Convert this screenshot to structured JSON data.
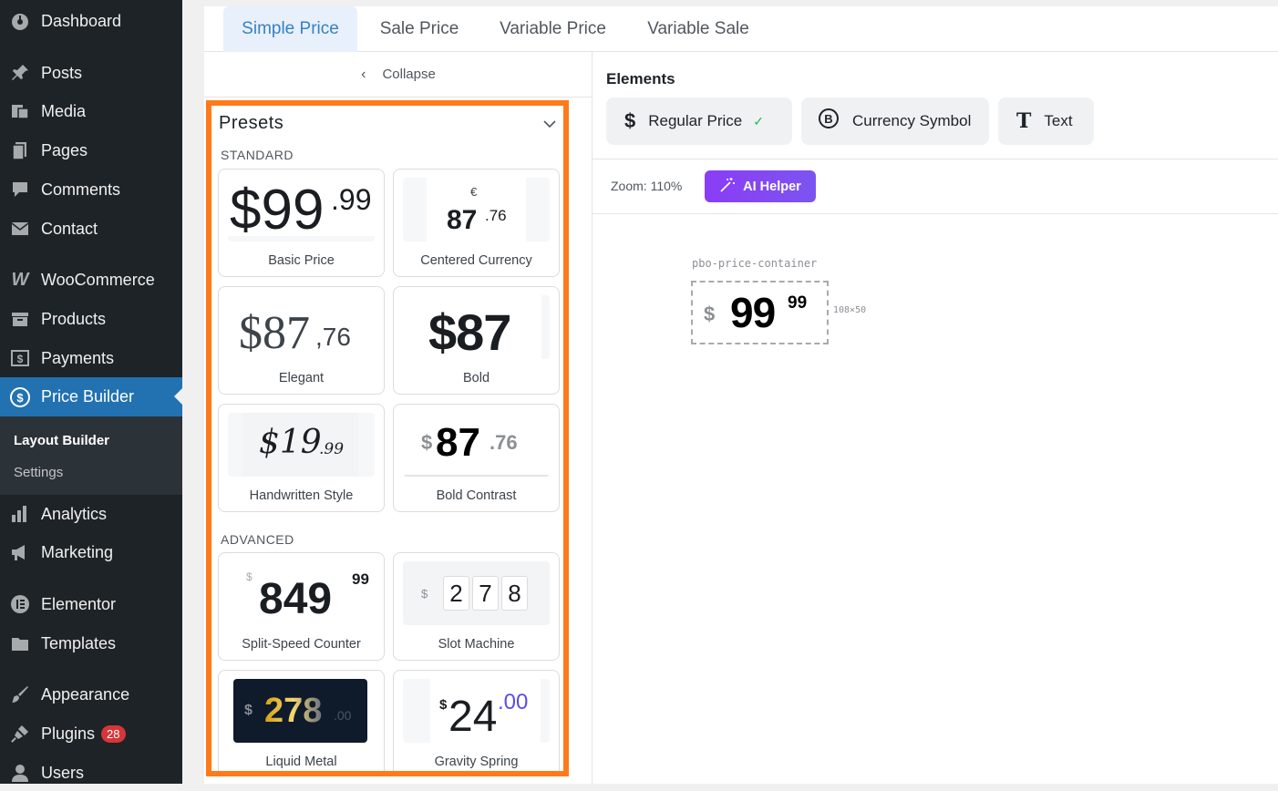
{
  "sidebar": {
    "items": [
      {
        "label": "Dashboard",
        "icon": "dashboard-icon"
      },
      {
        "label": "Posts",
        "icon": "pin-icon"
      },
      {
        "label": "Media",
        "icon": "media-icon"
      },
      {
        "label": "Pages",
        "icon": "pages-icon"
      },
      {
        "label": "Comments",
        "icon": "comment-icon"
      },
      {
        "label": "Contact",
        "icon": "mail-icon"
      },
      {
        "label": "WooCommerce",
        "icon": "woo-icon"
      },
      {
        "label": "Products",
        "icon": "archive-icon"
      },
      {
        "label": "Payments",
        "icon": "payment-icon"
      },
      {
        "label": "Price Builder",
        "icon": "dollar-circle-icon"
      },
      {
        "label": "Analytics",
        "icon": "bar-chart-icon"
      },
      {
        "label": "Marketing",
        "icon": "megaphone-icon"
      },
      {
        "label": "Elementor",
        "icon": "elementor-icon"
      },
      {
        "label": "Templates",
        "icon": "folder-icon"
      },
      {
        "label": "Appearance",
        "icon": "brush-icon"
      },
      {
        "label": "Plugins",
        "icon": "plugin-icon",
        "badge": "28"
      },
      {
        "label": "Users",
        "icon": "user-icon"
      }
    ],
    "submenu": [
      {
        "label": "Layout Builder"
      },
      {
        "label": "Settings"
      }
    ]
  },
  "tabs": [
    "Simple Price",
    "Sale Price",
    "Variable Price",
    "Variable Sale"
  ],
  "collapse_label": "Collapse",
  "presets": {
    "title": "Presets",
    "standard_label": "STANDARD",
    "advanced_label": "ADVANCED",
    "cards": [
      {
        "label": "Basic Price",
        "main": "$99",
        "cents": ".99"
      },
      {
        "label": "Centered Currency",
        "currency": "€",
        "main": "87",
        "cents": ".76"
      },
      {
        "label": "Elegant",
        "main": "$87",
        "cents": ",76"
      },
      {
        "label": "Bold",
        "main": "$87"
      },
      {
        "label": "Handwritten Style",
        "main": "$19",
        "cents": ".99"
      },
      {
        "label": "Bold Contrast",
        "currency": "$",
        "main": "87",
        "cents": ".76"
      },
      {
        "label": "Split-Speed Counter",
        "currency": "$",
        "main": "849",
        "cents": "99"
      },
      {
        "label": "Slot Machine",
        "currency": "$",
        "digits": [
          "2",
          "7",
          "8"
        ]
      },
      {
        "label": "Liquid Metal",
        "currency": "$",
        "main": "278",
        "cents": ".00"
      },
      {
        "label": "Gravity Spring",
        "currency": "$",
        "main": "24",
        "cents": ".00"
      }
    ]
  },
  "elements": {
    "title": "Elements",
    "buttons": [
      {
        "label": "Regular Price",
        "icon": "dollar-icon",
        "checked": "✓"
      },
      {
        "label": "Currency Symbol",
        "icon": "bitcoin-icon"
      },
      {
        "label": "Text",
        "icon": "text-icon"
      }
    ]
  },
  "canvas": {
    "zoom": "Zoom: 110%",
    "ai_helper": "AI Helper",
    "container_name": "pbo-price-container",
    "price_currency": "$",
    "price_main": "99",
    "price_cents": "99",
    "dimensions": "108×50"
  },
  "colors": {
    "sidebar_bg": "#1d2327",
    "active_blue": "#2271b1",
    "highlight_orange": "#ff7a1a",
    "ai_purple": "#8b3cf6"
  }
}
